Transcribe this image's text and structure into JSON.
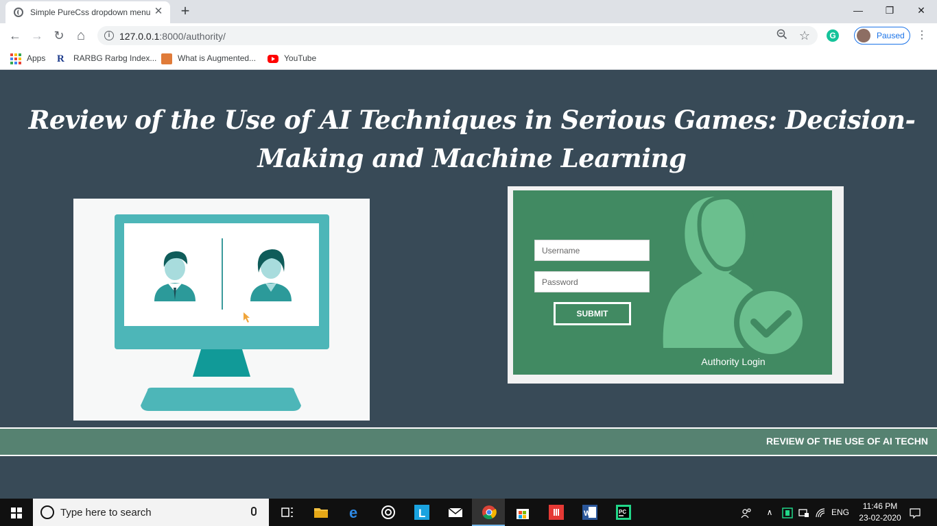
{
  "browser": {
    "tab_title": "Simple PureCss dropdown menu",
    "tab_close": "✕",
    "new_tab": "+",
    "url_host": "127.0.0.1",
    "url_path": ":8000/authority/",
    "profile_status": "Paused",
    "window_controls": {
      "minimize": "—",
      "maximize": "❐",
      "close": "✕"
    },
    "nav": {
      "back": "←",
      "forward": "→",
      "reload": "↻",
      "home": "⌂"
    },
    "bookmarks": [
      {
        "label": "Apps",
        "icon": "apps-grid-icon"
      },
      {
        "label": "RARBG Rarbg Index...",
        "icon": "rarbg-icon",
        "icon_text": "R"
      },
      {
        "label": "What is Augmented...",
        "icon": "augmented-icon"
      },
      {
        "label": "YouTube",
        "icon": "youtube-icon"
      }
    ]
  },
  "page": {
    "title": "Review of the Use of AI Techniques in Serious Games: Decision-Making and Machine Learning",
    "login": {
      "username_placeholder": "Username",
      "password_placeholder": "Password",
      "submit_label": "SUBMIT",
      "caption": "Authority Login"
    },
    "marquee_text": "REVIEW OF THE USE OF AI TECHN"
  },
  "taskbar": {
    "search_placeholder": "Type here to search",
    "language": "ENG",
    "time": "11:46 PM",
    "date": "23-02-2020"
  },
  "colors": {
    "page_bg": "#384a57",
    "login_green": "#418a62",
    "teal": "#4db6b8",
    "marquee_bg": "#568271"
  }
}
